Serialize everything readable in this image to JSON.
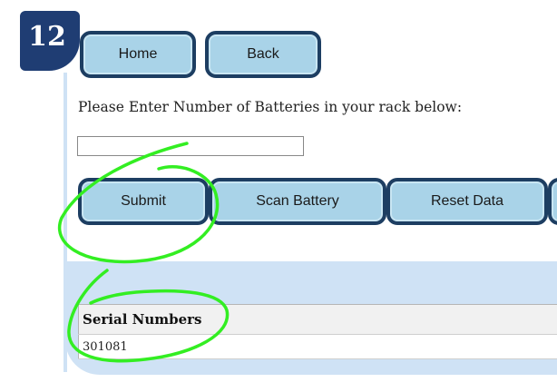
{
  "step_badge": "12",
  "nav": {
    "home_label": "Home",
    "back_label": "Back"
  },
  "form": {
    "prompt": "Please Enter Number of Batteries in your rack below:",
    "battery_count_value": "",
    "battery_count_placeholder": ""
  },
  "actions": {
    "submit_label": "Submit",
    "scan_label": "Scan Battery",
    "reset_label": "Reset Data"
  },
  "serial_table": {
    "header": "Serial Numbers",
    "rows": [
      "301081"
    ]
  },
  "colors": {
    "button_fill": "#a9d3e8",
    "button_border": "#1d3e62",
    "badge": "#1f3d73",
    "panel": "#cfe2f5",
    "annotation": "#33ee22"
  }
}
